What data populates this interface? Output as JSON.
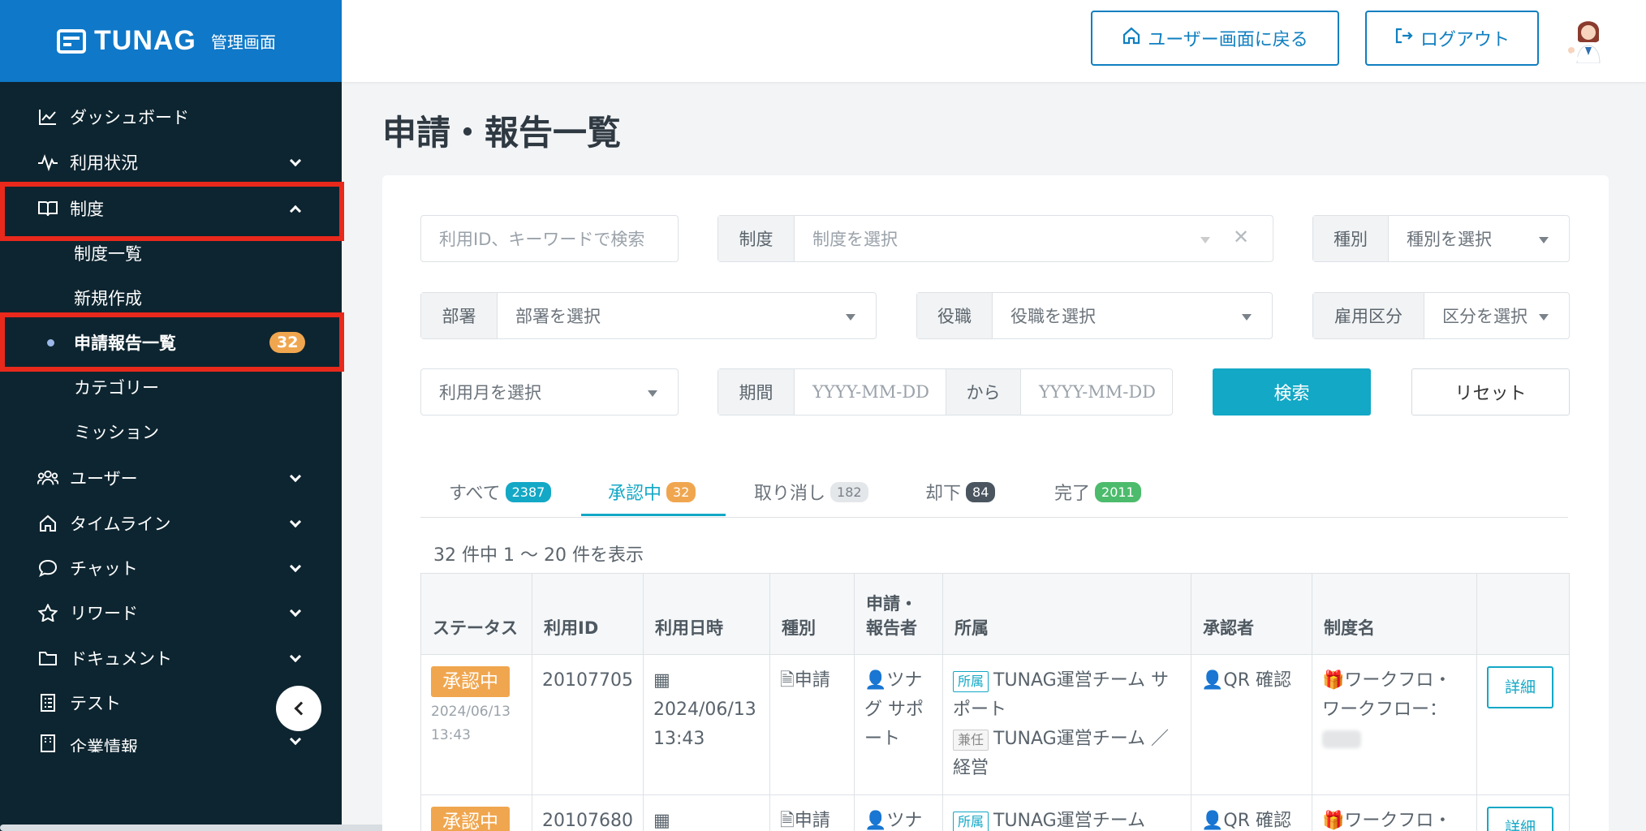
{
  "brand": {
    "name": "TUNAG",
    "subtitle": "管理画面"
  },
  "header": {
    "back_label": "ユーザー画面に戻る",
    "logout_label": "ログアウト"
  },
  "sidebar": {
    "items": [
      {
        "label": "ダッシュボード",
        "icon": "chart-line-icon"
      },
      {
        "label": "利用状況",
        "icon": "activity-icon"
      },
      {
        "label": "制度",
        "icon": "book-icon"
      },
      {
        "label": "制度一覧"
      },
      {
        "label": "新規作成"
      },
      {
        "label": "申請報告一覧",
        "badge": "32"
      },
      {
        "label": "カテゴリー"
      },
      {
        "label": "ミッション"
      },
      {
        "label": "ユーザー",
        "icon": "users-icon"
      },
      {
        "label": "タイムライン",
        "icon": "home-icon"
      },
      {
        "label": "チャット",
        "icon": "chat-icon"
      },
      {
        "label": "リワード",
        "icon": "star-icon"
      },
      {
        "label": "ドキュメント",
        "icon": "folder-icon"
      },
      {
        "label": "テスト",
        "icon": "test-icon"
      },
      {
        "label": "企業情報",
        "icon": "building-icon"
      }
    ]
  },
  "page": {
    "title": "申請・報告一覧"
  },
  "filters": {
    "keyword_placeholder": "利用ID、キーワードで検索",
    "system_label": "制度",
    "system_placeholder": "制度を選択",
    "type_label": "種別",
    "type_placeholder": "種別を選択",
    "dept_label": "部署",
    "dept_placeholder": "部署を選択",
    "position_label": "役職",
    "position_placeholder": "役職を選択",
    "employment_label": "雇用区分",
    "employment_placeholder": "区分を選択",
    "month_placeholder": "利用月を選択",
    "period_label": "期間",
    "date_placeholder": "YYYY-MM-DD",
    "from_label": "から",
    "search_label": "検索",
    "reset_label": "リセット"
  },
  "tabs": [
    {
      "label": "すべて",
      "count": "2387",
      "color": "#13a8c6"
    },
    {
      "label": "承認中",
      "count": "32",
      "color": "#f0a64f"
    },
    {
      "label": "取り消し",
      "count": "182",
      "color": "#e4e7ea"
    },
    {
      "label": "却下",
      "count": "84",
      "color": "#4a5560"
    },
    {
      "label": "完了",
      "count": "2011",
      "color": "#4cbb6c"
    }
  ],
  "result_count": "32 件中 1 〜 20 件を表示",
  "table": {
    "headers": {
      "status": "ステータス",
      "id": "利用ID",
      "datetime": "利用日時",
      "kind": "種別",
      "applicant": "申請・報告者",
      "affiliation": "所属",
      "approver": "承認者",
      "system": "制度名"
    },
    "rows": [
      {
        "status": "承認中",
        "status_date": "2024/06/13",
        "status_time": "13:43",
        "id": "20107705",
        "date": "2024/06/13",
        "time": "13:43",
        "kind": "申請",
        "applicant": "ツナグ サポート",
        "tag1": "所属",
        "aff1": "TUNAG運営チーム サポート",
        "tag2": "兼任",
        "aff2": "TUNAG運営チーム ／経営",
        "approver": "QR 確認",
        "system": "ワークフロ・ワークフロー：",
        "detail": "詳細"
      },
      {
        "status": "承認中",
        "id": "20107680",
        "kind": "申請",
        "applicant": "ツナ",
        "tag1": "所属",
        "aff1": "TUNAG運営チーム",
        "approver": "QR 確認",
        "system": "ワークフロ・",
        "detail": "詳細"
      }
    ]
  }
}
